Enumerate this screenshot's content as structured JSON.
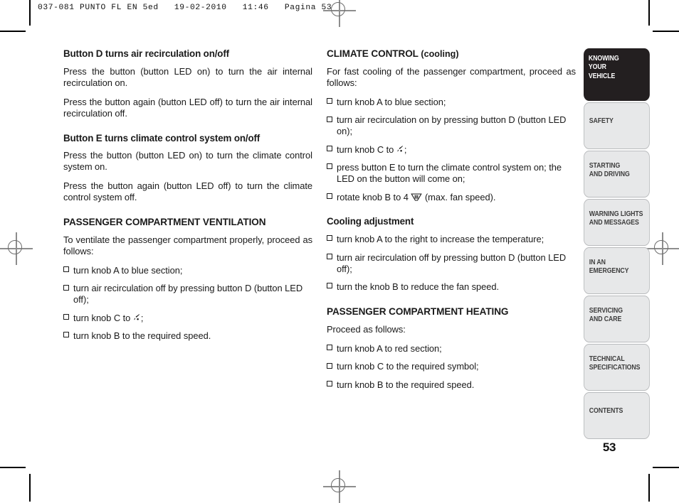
{
  "running_head": "037-081 PUNTO FL EN 5ed   19-02-2010   11:46   Pagina 53",
  "folio": "53",
  "left_column": {
    "heading_1": "Button D turns air recirculation on/off",
    "para_1": "Press the button (button LED on) to turn the air internal recirculation on.",
    "para_2": "Press the button again (button LED off) to turn the air internal recirculation off.",
    "heading_2": "Button E turns climate control system on/off",
    "para_3": "Press the button (button LED on) to turn the climate control system on.",
    "para_4": "Press the button again (button LED off) to turn the climate control system off.",
    "heading_3": "PASSENGER COMPARTMENT VENTILATION",
    "para_5": "To ventilate the passenger compartment properly, proceed as follows:",
    "items": [
      "turn knob A to blue section;",
      "turn air recirculation off by pressing button D (button LED off);",
      "turn knob B to the required speed."
    ],
    "item_knob_c_prefix": "turn knob C to ",
    "item_knob_c_suffix": ";"
  },
  "right_column": {
    "heading_1_main": "CLIMATE CONTROL",
    "heading_1_sub": " (cooling)",
    "para_1": "For fast cooling of the passenger compartment, proceed as follows:",
    "items_cooling": [
      "turn knob A to blue section;",
      "turn air recirculation on by pressing button D (button LED on);"
    ],
    "item_knob_c_prefix": "turn knob C to ",
    "item_knob_c_suffix": ";",
    "item_press_e": "press button E to turn the climate control system on; the LED on the button will come on;",
    "item_rotate_b_prefix": "rotate knob B to 4 ",
    "item_rotate_b_suffix": " (max. fan speed).",
    "heading_2": "Cooling adjustment",
    "items_adjust": [
      "turn knob A to the right to increase the temperature;",
      "turn air recirculation off by pressing button D (button LED off);",
      " turn the knob B to reduce the fan speed."
    ],
    "heading_3": "PASSENGER COMPARTMENT HEATING",
    "para_2": "Proceed as follows:",
    "items_heating": [
      "turn knob A to red section;",
      "turn knob C to the required symbol;",
      "turn knob B to the required speed."
    ]
  },
  "tabs": [
    {
      "label": "KNOWING\nYOUR\nVEHICLE",
      "active": true,
      "lines": 3
    },
    {
      "label": "SAFETY",
      "active": false,
      "lines": 1
    },
    {
      "label": "STARTING\nAND DRIVING",
      "active": false,
      "lines": 2
    },
    {
      "label": "WARNING LIGHTS\nAND MESSAGES",
      "active": false,
      "lines": 2
    },
    {
      "label": "IN AN\nEMERGENCY",
      "active": false,
      "lines": 2
    },
    {
      "label": "SERVICING\nAND CARE",
      "active": false,
      "lines": 2
    },
    {
      "label": "TECHNICAL\nSPECIFICATIONS",
      "active": false,
      "lines": 2
    },
    {
      "label": "CONTENTS",
      "active": false,
      "lines": 1
    }
  ],
  "icons": {
    "vent": "face-vent-airflow-icon",
    "fan": "blower-fan-icon"
  },
  "colors": {
    "tab_active_bg": "#231f20",
    "tab_idle_bg": "#e7e8e9",
    "tab_idle_border": "#b9bbbd",
    "text": "#1a1a1a",
    "regmark": "#8d8d8d"
  }
}
